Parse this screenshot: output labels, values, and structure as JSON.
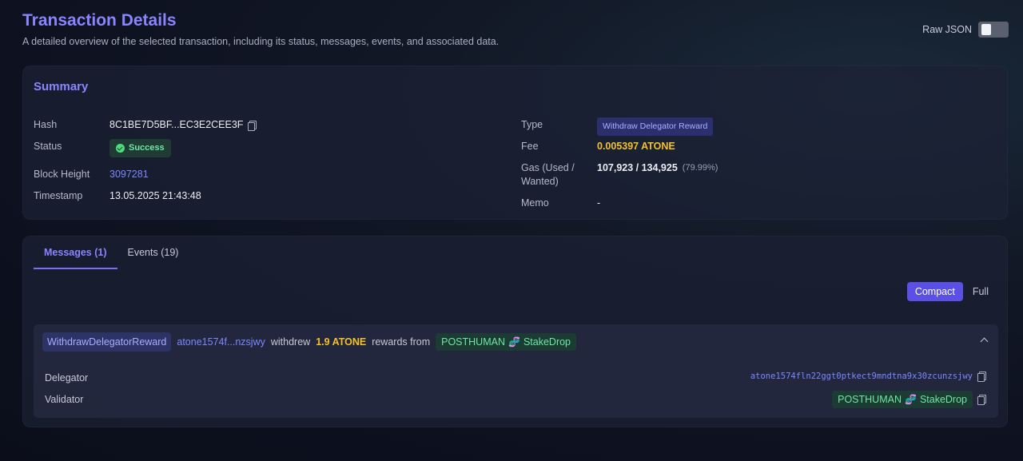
{
  "header": {
    "title": "Transaction Details",
    "subtitle": "A detailed overview of the selected transaction, including its status, messages, events, and associated data.",
    "raw_json_label": "Raw JSON"
  },
  "summary": {
    "title": "Summary",
    "hash_label": "Hash",
    "hash_value": "8C1BE7D5BF...EC3E2CEE3F",
    "status_label": "Status",
    "status_value": "Success",
    "block_height_label": "Block Height",
    "block_height_value": "3097281",
    "timestamp_label": "Timestamp",
    "timestamp_value": "13.05.2025 21:43:48",
    "type_label": "Type",
    "type_value": "Withdraw Delegator Reward",
    "fee_label": "Fee",
    "fee_value": "0.005397 ATONE",
    "gas_label": "Gas (Used / Wanted)",
    "gas_value": "107,923 / 134,925",
    "gas_percent": "(79.99%)",
    "memo_label": "Memo",
    "memo_value": "-"
  },
  "tabs": [
    {
      "label": "Messages (1)",
      "active": true
    },
    {
      "label": "Events (19)",
      "active": false
    }
  ],
  "view_switch": {
    "compact_label": "Compact",
    "full_label": "Full",
    "selected": "Compact"
  },
  "message": {
    "type": "WithdrawDelegatorReward",
    "address_short": "atone1574f...nzsjwy",
    "verb": "withdrew",
    "amount": "1.9 ATONE",
    "rewards_from": "rewards from",
    "validator_name": "POSTHUMAN",
    "validator_suffix": "StakeDrop",
    "delegator_label": "Delegator",
    "delegator_value": "atone1574fln22ggt0ptkect9mndtna9x30zcunzsjwy",
    "validator_label": "Validator"
  },
  "colors": {
    "accent": "#8a84ff",
    "success": "#6ee7a6",
    "fee": "#f4c226",
    "link": "#7d87ff",
    "compact_active": "#5b50e6"
  },
  "icons": [
    "copy-icon",
    "check-icon",
    "dna-icon",
    "chevron-up-icon"
  ]
}
